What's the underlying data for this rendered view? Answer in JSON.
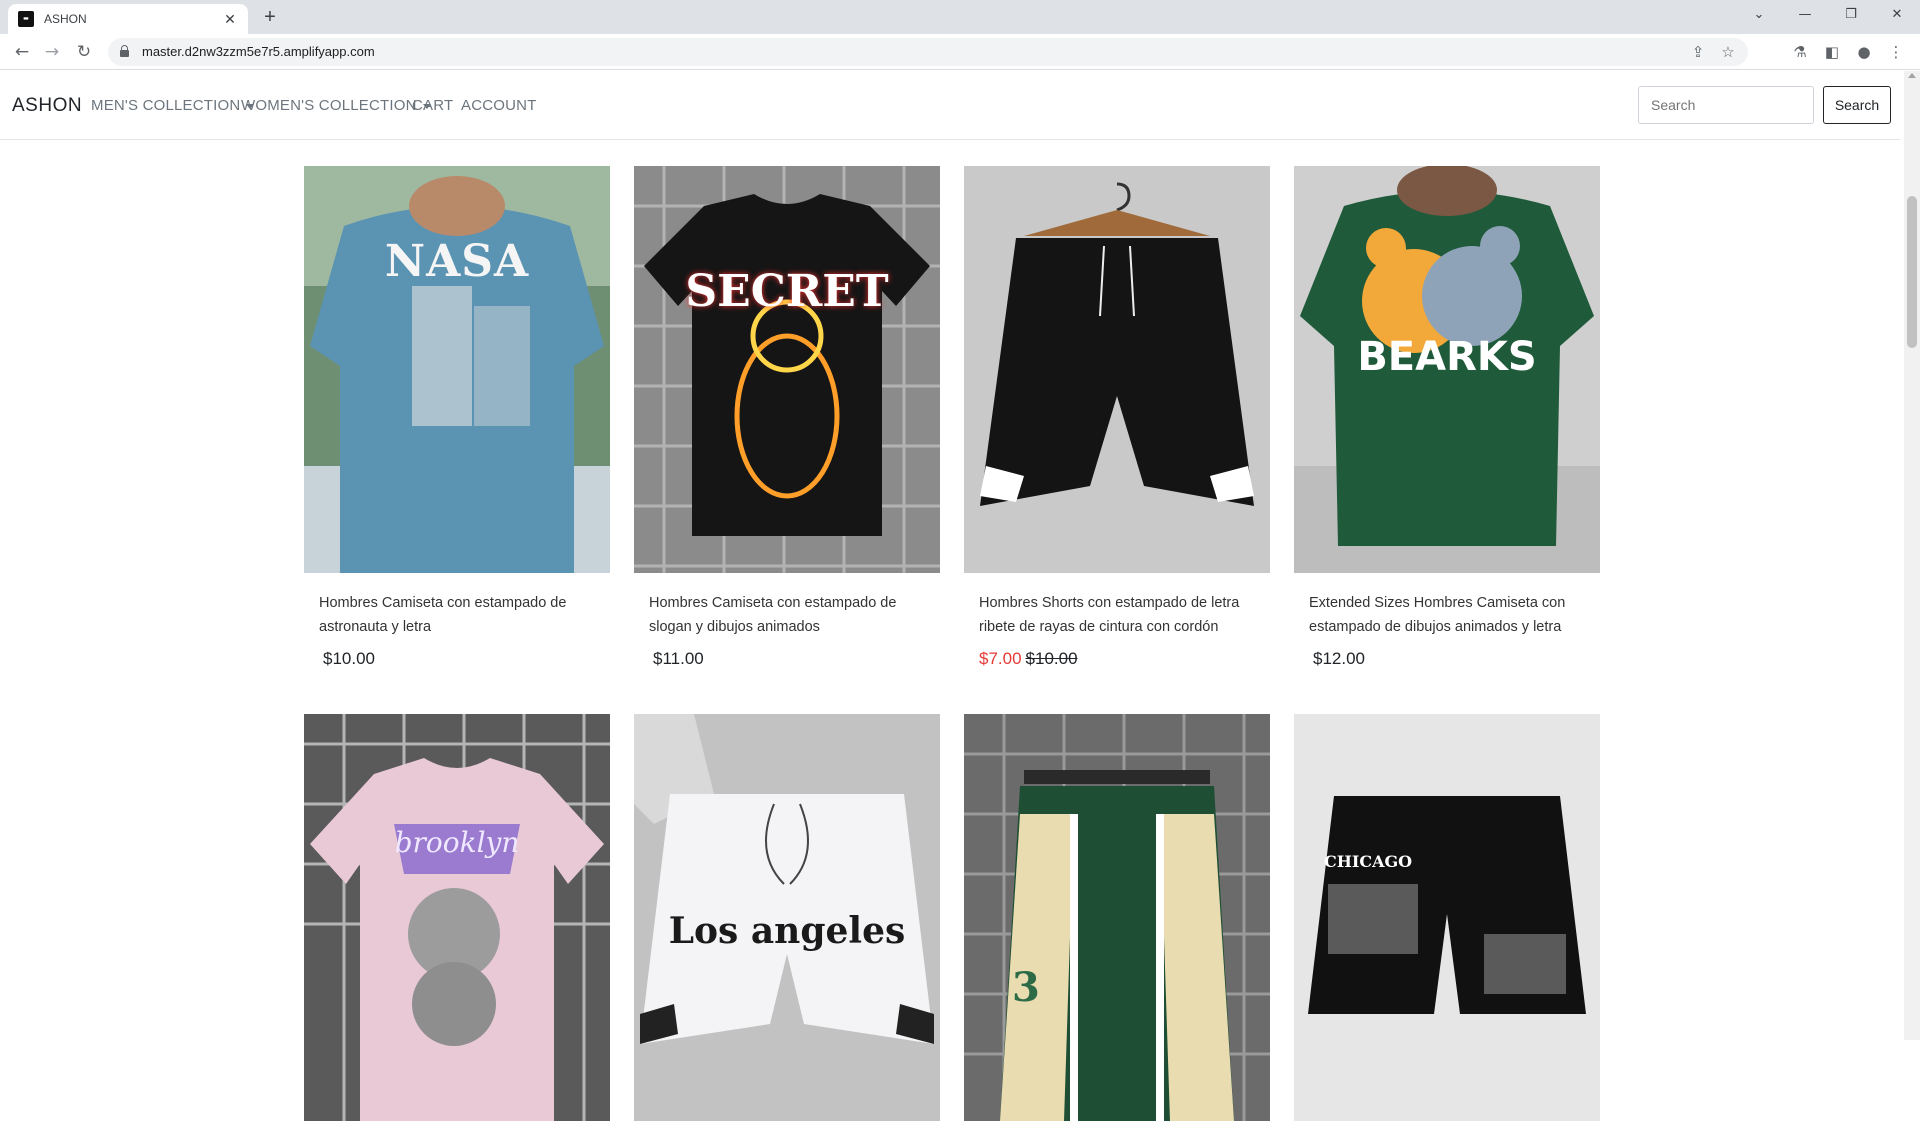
{
  "browser": {
    "tab_title": "ASHON",
    "favicon_text": "ASHON",
    "url": "master.d2nw3zzm5e7r5.amplifyapp.com"
  },
  "nav": {
    "brand": "ASHON",
    "mens": "MEN'S COLLECTION",
    "womens": "WOMEN'S COLLECTION",
    "cart": "CART",
    "account": "ACCOUNT",
    "search_placeholder": "Search",
    "search_button": "Search"
  },
  "products": [
    {
      "name": "Hombres Camiseta con estampado de astronauta y letra",
      "price": "$10.00",
      "sale_price": "",
      "print": "NASA",
      "colors": {
        "bg": "#6f8f73",
        "garment": "#5b93b3"
      }
    },
    {
      "name": "Hombres Camiseta con estampado de slogan y dibujos animados",
      "price": "$11.00",
      "sale_price": "",
      "print": "SECRET",
      "colors": {
        "bg": "#8b8b8b",
        "garment": "#151515"
      }
    },
    {
      "name": "Hombres Shorts con estampado de letra ribete de rayas de cintura con cordón",
      "price": "$10.00",
      "sale_price": "$7.00",
      "print": "",
      "colors": {
        "bg": "#c9c9c9",
        "garment": "#141414"
      }
    },
    {
      "name": "Extended Sizes Hombres Camiseta con estampado de dibujos animados y letra",
      "price": "$12.00",
      "sale_price": "",
      "print": "BEARKS",
      "colors": {
        "bg": "#cfcfcf",
        "garment": "#1f5a3a"
      }
    },
    {
      "name": "",
      "price": "",
      "sale_price": "",
      "print": "brooklyn",
      "colors": {
        "bg": "#5a5a5a",
        "garment": "#e9c9d6"
      }
    },
    {
      "name": "",
      "price": "",
      "sale_price": "",
      "print": "Los angeles",
      "colors": {
        "bg": "#c2c2c2",
        "garment": "#f4f4f6"
      }
    },
    {
      "name": "",
      "price": "",
      "sale_price": "",
      "print": "3",
      "colors": {
        "bg": "#6b6b6b",
        "garment": "#1e4f34"
      }
    },
    {
      "name": "",
      "price": "",
      "sale_price": "",
      "print": "CHICAGO",
      "colors": {
        "bg": "#e6e6e6",
        "garment": "#111111"
      }
    }
  ]
}
